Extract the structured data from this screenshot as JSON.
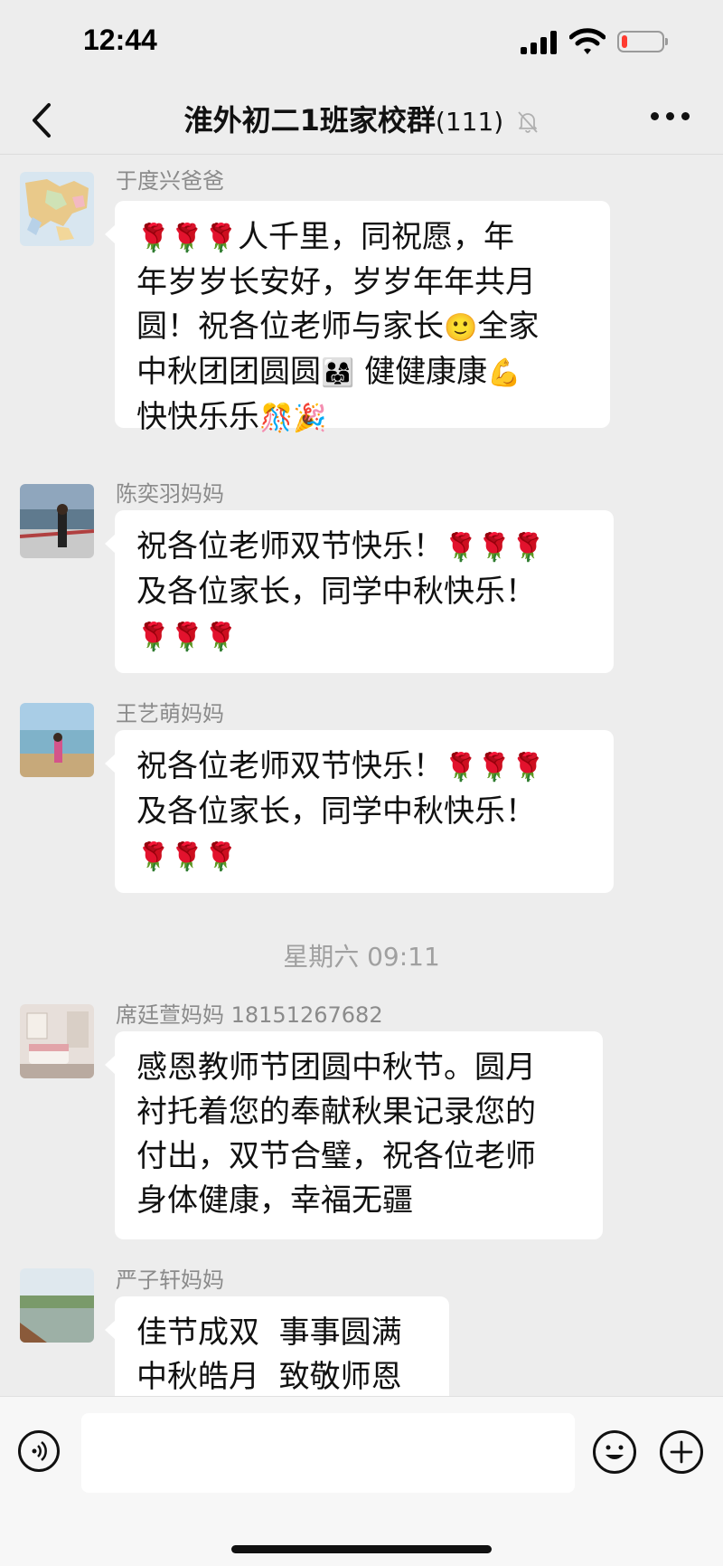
{
  "status_bar": {
    "time": "12:44",
    "battery_level": 0.15
  },
  "nav": {
    "title": "淮外初二1班家校群",
    "member_count": "(111)"
  },
  "messages": [
    {
      "sender": "于度兴爸爸",
      "lines": [
        [
          "🌹🌹🌹",
          "人千里，同祝愿，年"
        ],
        [
          "年岁岁长安好，岁岁年年共月"
        ],
        [
          "圆！祝各位老师与家长",
          "🙂",
          "全家"
        ],
        [
          "中秋团团圆圆",
          "👨‍👩‍👧",
          " 健健康康",
          "💪"
        ],
        [
          "快快乐乐",
          "🎊🎉"
        ]
      ]
    },
    {
      "sender": "陈奕羽妈妈",
      "lines": [
        [
          "祝各位老师双节快乐！",
          "🌹🌹🌹"
        ],
        [
          "及各位家长，同学中秋快乐！"
        ],
        [
          "🌹🌹🌹"
        ]
      ]
    },
    {
      "sender": "王艺萌妈妈",
      "lines": [
        [
          "祝各位老师双节快乐！",
          "🌹🌹🌹"
        ],
        [
          "及各位家长，同学中秋快乐！"
        ],
        [
          "🌹🌹🌹"
        ]
      ]
    },
    {
      "sender": "席廷萱妈妈 18151267682",
      "lines": [
        [
          "感恩教师节团圆中秋节。圆月"
        ],
        [
          "衬托着您的奉献秋果记录您的"
        ],
        [
          "付出，双节合璧，祝各位老师"
        ],
        [
          "身体健康，幸福无疆"
        ]
      ]
    },
    {
      "sender": "严子轩妈妈",
      "lines": [
        [
          "佳节成双  事事圆满"
        ],
        [
          "中秋皓月  致敬师恩"
        ]
      ]
    }
  ],
  "timestamp": "星期六 09:11",
  "input": {
    "value": ""
  },
  "icons": {
    "back": "chevron-left-icon",
    "mute": "bell-off-icon",
    "more": "more-dots-icon",
    "voice": "voice-icon",
    "emoji": "smile-icon",
    "plus": "plus-icon"
  }
}
